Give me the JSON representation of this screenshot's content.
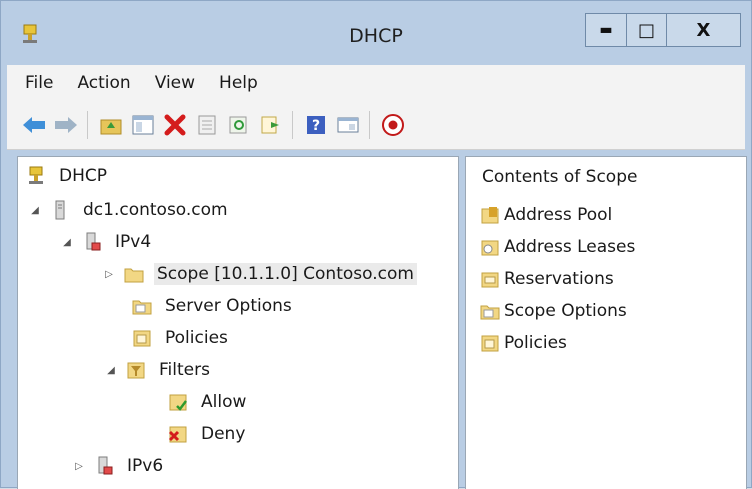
{
  "window": {
    "title": "DHCP"
  },
  "titlebar_buttons": {
    "minimize": "▬",
    "maximize": "□",
    "close": "X"
  },
  "menu": [
    "File",
    "Action",
    "View",
    "Help"
  ],
  "toolbar_icons": [
    "back-arrow-icon",
    "forward-arrow-icon",
    "up-folder-icon",
    "show-hide-tree-icon",
    "delete-icon",
    "properties-icon",
    "refresh-icon",
    "export-list-icon",
    "help-icon",
    "console-icon",
    "stop-icon"
  ],
  "tree": {
    "root": "DHCP",
    "server": "dc1.contoso.com",
    "ipv4": "IPv4",
    "scope": "Scope [10.1.1.0] Contoso.com",
    "server_options": "Server Options",
    "policies": "Policies",
    "filters": "Filters",
    "allow": "Allow",
    "deny": "Deny",
    "ipv6": "IPv6"
  },
  "content": {
    "title": "Contents of Scope",
    "items": [
      "Address Pool",
      "Address Leases",
      "Reservations",
      "Scope Options",
      "Policies"
    ]
  }
}
